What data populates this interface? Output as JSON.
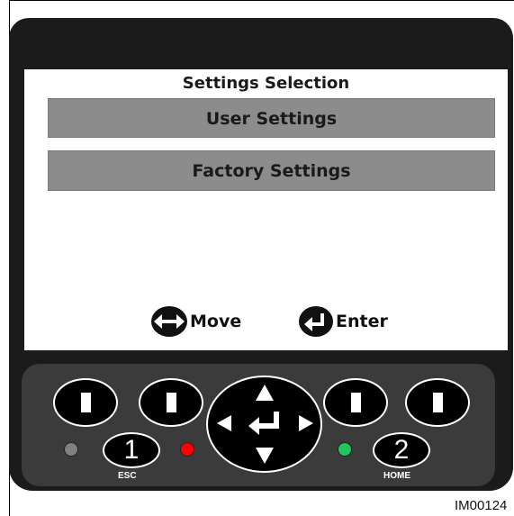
{
  "screen": {
    "title": "Settings Selection",
    "menu": [
      {
        "label": "User Settings",
        "selected": true
      },
      {
        "label": "Factory Settings",
        "selected": false
      }
    ],
    "hints": {
      "move_label": "Move",
      "enter_label": "Enter"
    }
  },
  "keypad": {
    "soft_keys": [
      "soft-key-1",
      "soft-key-2",
      "soft-key-3",
      "soft-key-4"
    ],
    "dpad_center_icon": "enter-arrow-icon",
    "button_1": {
      "number": "1",
      "label": "ESC"
    },
    "button_2": {
      "number": "2",
      "label": "HOME"
    }
  },
  "leds": {
    "left": "#808080",
    "middle": "#ff0000",
    "right": "#22c55e"
  },
  "colors": {
    "device_body": "#1b1b1b",
    "panel": "#3b3b3b",
    "menu_item_bg": "#8c8c8c"
  },
  "figure_id": "IM00124"
}
